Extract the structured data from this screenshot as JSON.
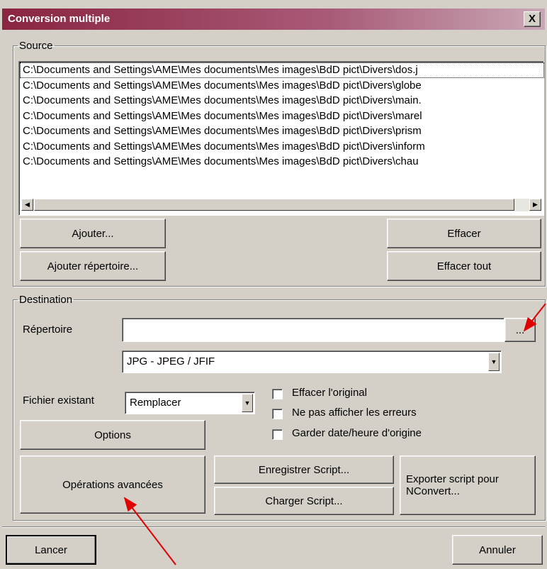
{
  "window": {
    "title": "Conversion multiple",
    "close_label": "X"
  },
  "source": {
    "legend": "Source",
    "files": [
      "C:\\Documents and Settings\\AME\\Mes documents\\Mes images\\BdD pict\\Divers\\dos.j",
      "C:\\Documents and Settings\\AME\\Mes documents\\Mes images\\BdD pict\\Divers\\globe",
      "C:\\Documents and Settings\\AME\\Mes documents\\Mes images\\BdD pict\\Divers\\main.",
      "C:\\Documents and Settings\\AME\\Mes documents\\Mes images\\BdD pict\\Divers\\marel",
      "C:\\Documents and Settings\\AME\\Mes documents\\Mes images\\BdD pict\\Divers\\prism",
      "C:\\Documents and Settings\\AME\\Mes documents\\Mes images\\BdD pict\\Divers\\inform",
      "C:\\Documents and Settings\\AME\\Mes documents\\Mes images\\BdD pict\\Divers\\chau"
    ],
    "add_label": "Ajouter...",
    "add_folder_label": "Ajouter répertoire...",
    "clear_label": "Effacer",
    "clear_all_label": "Effacer tout"
  },
  "destination": {
    "legend": "Destination",
    "folder_label": "Répertoire",
    "folder_value": "",
    "browse_label": "...",
    "format_value": "JPG - JPEG / JFIF",
    "existing_label": "Fichier existant",
    "existing_value": "Remplacer",
    "checkboxes": [
      {
        "label": "Effacer l'original",
        "checked": false
      },
      {
        "label": "Ne pas afficher les erreurs",
        "checked": false
      },
      {
        "label": "Garder date/heure d'origine",
        "checked": false
      }
    ],
    "options_label": "Options",
    "advanced_label": "Opérations avancées",
    "save_script_label": "Enregistrer Script...",
    "load_script_label": "Charger Script...",
    "export_script_label": "Exporter script pour NConvert..."
  },
  "footer": {
    "start_label": "Lancer",
    "cancel_label": "Annuler"
  },
  "annotation_color": "#e00000"
}
